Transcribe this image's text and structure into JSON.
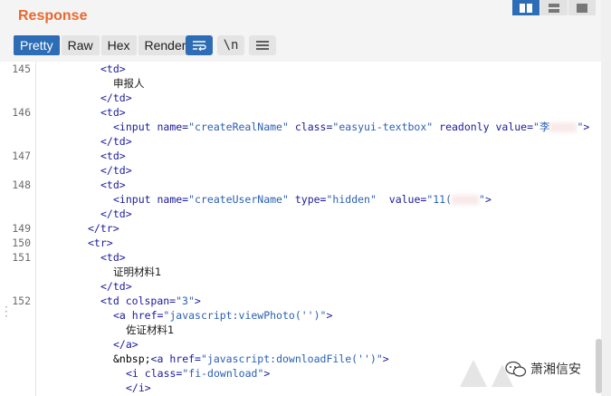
{
  "panel": {
    "title": "Response"
  },
  "tabs": [
    {
      "label": "Pretty",
      "active": true
    },
    {
      "label": "Raw",
      "active": false
    },
    {
      "label": "Hex",
      "active": false
    },
    {
      "label": "Render",
      "active": false
    }
  ],
  "toolbar": {
    "newline_label": "\\n"
  },
  "code": {
    "line_numbers": [
      "145",
      "146",
      "147",
      "148",
      "149",
      "150",
      "151",
      "152"
    ],
    "text_145": "申报人",
    "attr_name_146": "createRealName",
    "attr_class_146": "easyui-textbox",
    "attr_value_146": "李",
    "attr_name_148": "createUserName",
    "attr_type_148": "hidden",
    "attr_value_148": "11(",
    "text_151": "证明材料1",
    "attr_colspan_152": "3",
    "href_view": "javascript:viewPhoto('')",
    "text_photo": "佐证材料1",
    "href_download": "javascript:downloadFile('')",
    "i_class": "fi-download",
    "nbsp": "&nbsp;"
  },
  "watermark": {
    "text": "萧湘信安"
  },
  "colors": {
    "accent": "#2d6db5",
    "title": "#e8692e",
    "tag": "#1a1a9c"
  }
}
